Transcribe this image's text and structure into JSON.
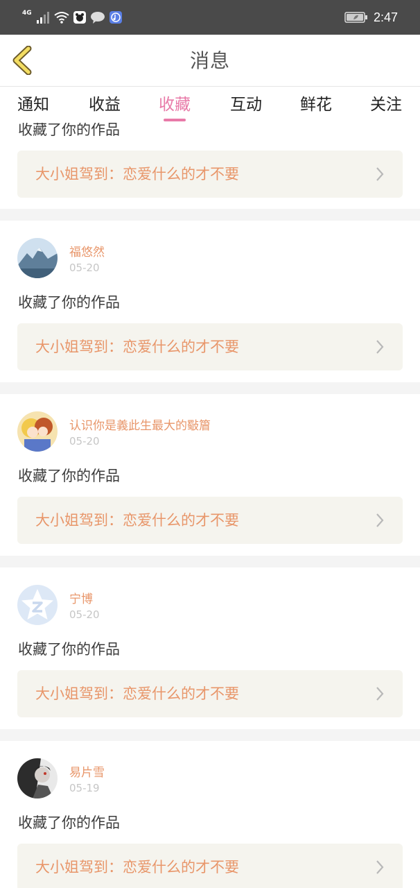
{
  "status_bar": {
    "network": "4G",
    "time": "2:47"
  },
  "header": {
    "title": "消息"
  },
  "tabs": [
    {
      "label": "通知"
    },
    {
      "label": "收益"
    },
    {
      "label": "收藏"
    },
    {
      "label": "互动"
    },
    {
      "label": "鲜花"
    },
    {
      "label": "关注"
    }
  ],
  "active_tab": "收藏",
  "colors": {
    "accent_pink": "#e87aa8",
    "username_orange": "#e8966a",
    "work_card_bg": "#f5f4ee"
  },
  "messages": [
    {
      "action": "收藏了你的作品",
      "work_title": "大小姐驾到：恋爱什么的才不要"
    },
    {
      "username": "福悠然",
      "date": "05-20",
      "action": "收藏了你的作品",
      "work_title": "大小姐驾到：恋爱什么的才不要"
    },
    {
      "username": "认识你是義此生最大的斀篃",
      "date": "05-20",
      "action": "收藏了你的作品",
      "work_title": "大小姐驾到：恋爱什么的才不要"
    },
    {
      "username": "宁博",
      "date": "05-20",
      "action": "收藏了你的作品",
      "work_title": "大小姐驾到：恋爱什么的才不要"
    },
    {
      "username": "易片雪",
      "date": "05-19",
      "action": "收藏了你的作品",
      "work_title": "大小姐驾到：恋爱什么的才不要"
    }
  ]
}
